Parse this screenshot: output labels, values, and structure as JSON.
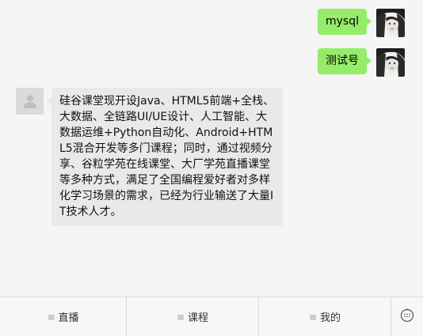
{
  "chat": {
    "messages": [
      {
        "side": "right",
        "text": "mysql",
        "avatar": "user-photo-icon"
      },
      {
        "side": "right",
        "text": "测试号",
        "avatar": "user-photo-icon"
      },
      {
        "side": "left",
        "avatar": "default-avatar-icon",
        "text": "硅谷课堂现开设Java、HTML5前端+全栈、大数据、全链路UI/UE设计、人工智能、大数据运维+Python自动化、Android+HTML5混合开发等多门课程；同时，通过视频分享、谷粒学苑在线课堂、大厂学苑直播课堂等多种方式，满足了全国编程爱好者对多样化学习场景的需求，已经为行业输送了大量IT技术人才。"
      }
    ]
  },
  "tabbar": {
    "tabs": [
      {
        "label": "直播",
        "icon": "menu-lines-icon"
      },
      {
        "label": "课程",
        "icon": "menu-lines-icon"
      },
      {
        "label": "我的",
        "icon": "menu-lines-icon"
      }
    ],
    "keyboard_icon": "emoji-keyboard-icon"
  },
  "colors": {
    "background": "#f5f5f5",
    "my_bubble": "#95ec69",
    "other_bubble": "#e9e9e9",
    "tabbar": "#f7f7f7"
  }
}
